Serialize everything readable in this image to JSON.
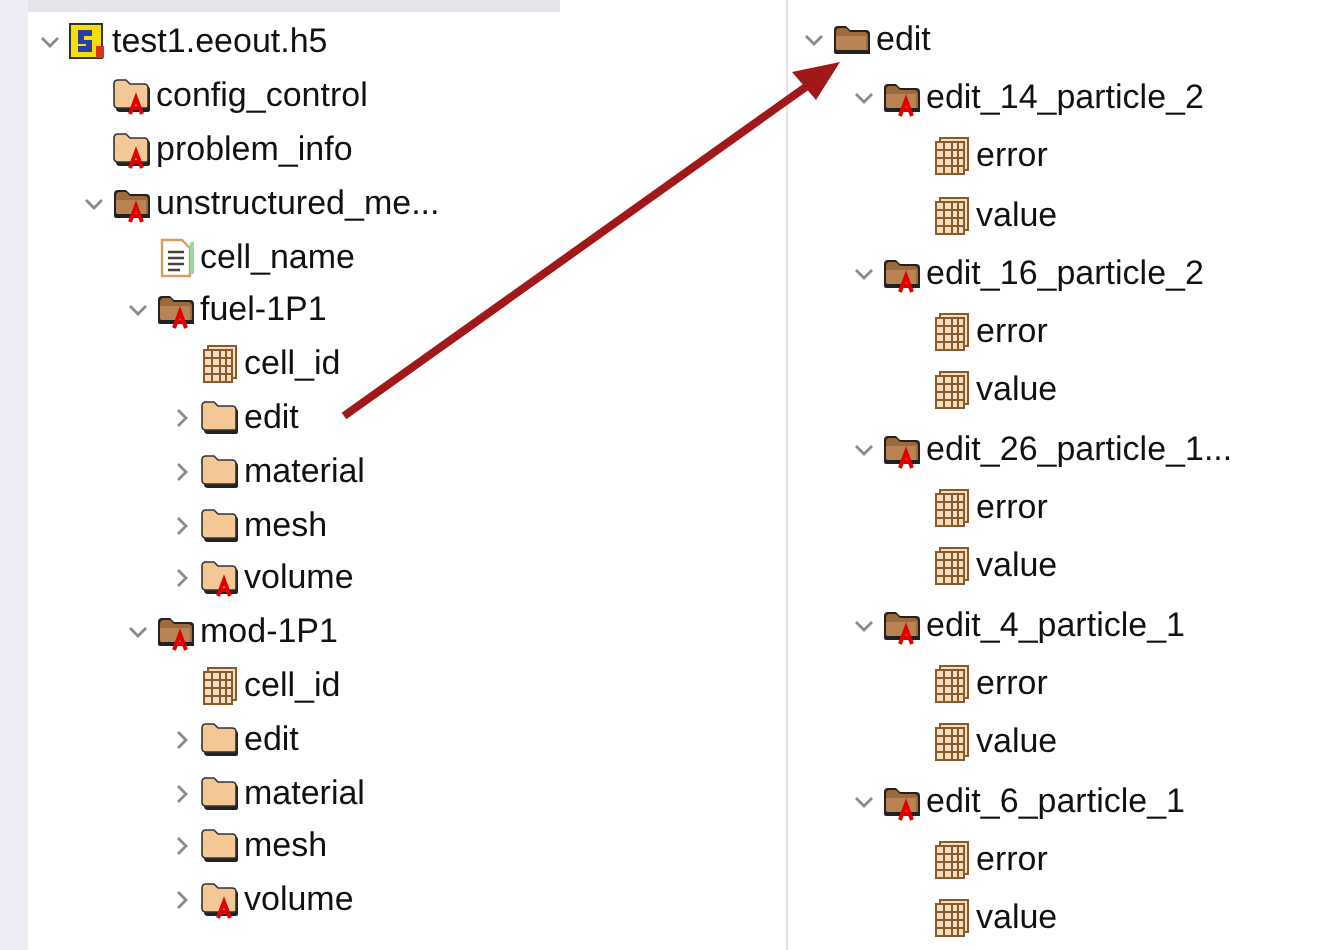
{
  "left_tree": {
    "nodes": [
      {
        "label": "test1.eeout.h5",
        "kind": "file",
        "attributes": false,
        "expanded": true,
        "children": [
          {
            "label": "config_control",
            "kind": "group",
            "attributes": true
          },
          {
            "label": "problem_info",
            "kind": "group",
            "attributes": true
          },
          {
            "label": "unstructured_me...",
            "kind": "group",
            "attributes": true,
            "expanded": true,
            "children": [
              {
                "label": "cell_name",
                "kind": "text",
                "attributes": false
              },
              {
                "label": "fuel-1P1",
                "kind": "group",
                "attributes": true,
                "expanded": true,
                "children": [
                  {
                    "label": "cell_id",
                    "kind": "dataset",
                    "attributes": false
                  },
                  {
                    "label": "edit",
                    "kind": "group",
                    "attributes": false,
                    "expanded": false
                  },
                  {
                    "label": "material",
                    "kind": "group",
                    "attributes": false,
                    "expanded": false
                  },
                  {
                    "label": "mesh",
                    "kind": "group",
                    "attributes": false,
                    "expanded": false
                  },
                  {
                    "label": "volume",
                    "kind": "group",
                    "attributes": true,
                    "expanded": false
                  }
                ]
              },
              {
                "label": "mod-1P1",
                "kind": "group",
                "attributes": true,
                "expanded": true,
                "children": [
                  {
                    "label": "cell_id",
                    "kind": "dataset",
                    "attributes": false
                  },
                  {
                    "label": "edit",
                    "kind": "group",
                    "attributes": false,
                    "expanded": false
                  },
                  {
                    "label": "material",
                    "kind": "group",
                    "attributes": false,
                    "expanded": false
                  },
                  {
                    "label": "mesh",
                    "kind": "group",
                    "attributes": false,
                    "expanded": false
                  },
                  {
                    "label": "volume",
                    "kind": "group",
                    "attributes": true,
                    "expanded": false
                  }
                ]
              }
            ]
          }
        ]
      }
    ]
  },
  "right_tree": {
    "nodes": [
      {
        "label": "edit",
        "kind": "group",
        "attributes": false,
        "expanded": true,
        "children": [
          {
            "label": "edit_14_particle_2",
            "kind": "group",
            "attributes": true,
            "expanded": true,
            "children": [
              {
                "label": "error",
                "kind": "dataset",
                "attributes": false
              },
              {
                "label": "value",
                "kind": "dataset",
                "attributes": false
              }
            ]
          },
          {
            "label": "edit_16_particle_2",
            "kind": "group",
            "attributes": true,
            "expanded": true,
            "children": [
              {
                "label": "error",
                "kind": "dataset",
                "attributes": false
              },
              {
                "label": "value",
                "kind": "dataset",
                "attributes": false
              }
            ]
          },
          {
            "label": "edit_26_particle_1...",
            "kind": "group",
            "attributes": true,
            "expanded": true,
            "children": [
              {
                "label": "error",
                "kind": "dataset",
                "attributes": false
              },
              {
                "label": "value",
                "kind": "dataset",
                "attributes": false
              }
            ]
          },
          {
            "label": "edit_4_particle_1",
            "kind": "group",
            "attributes": true,
            "expanded": true,
            "children": [
              {
                "label": "error",
                "kind": "dataset",
                "attributes": false
              },
              {
                "label": "value",
                "kind": "dataset",
                "attributes": false
              }
            ]
          },
          {
            "label": "edit_6_particle_1",
            "kind": "group",
            "attributes": true,
            "expanded": true,
            "children": [
              {
                "label": "error",
                "kind": "dataset",
                "attributes": false
              },
              {
                "label": "value",
                "kind": "dataset",
                "attributes": false
              }
            ]
          }
        ]
      }
    ]
  }
}
